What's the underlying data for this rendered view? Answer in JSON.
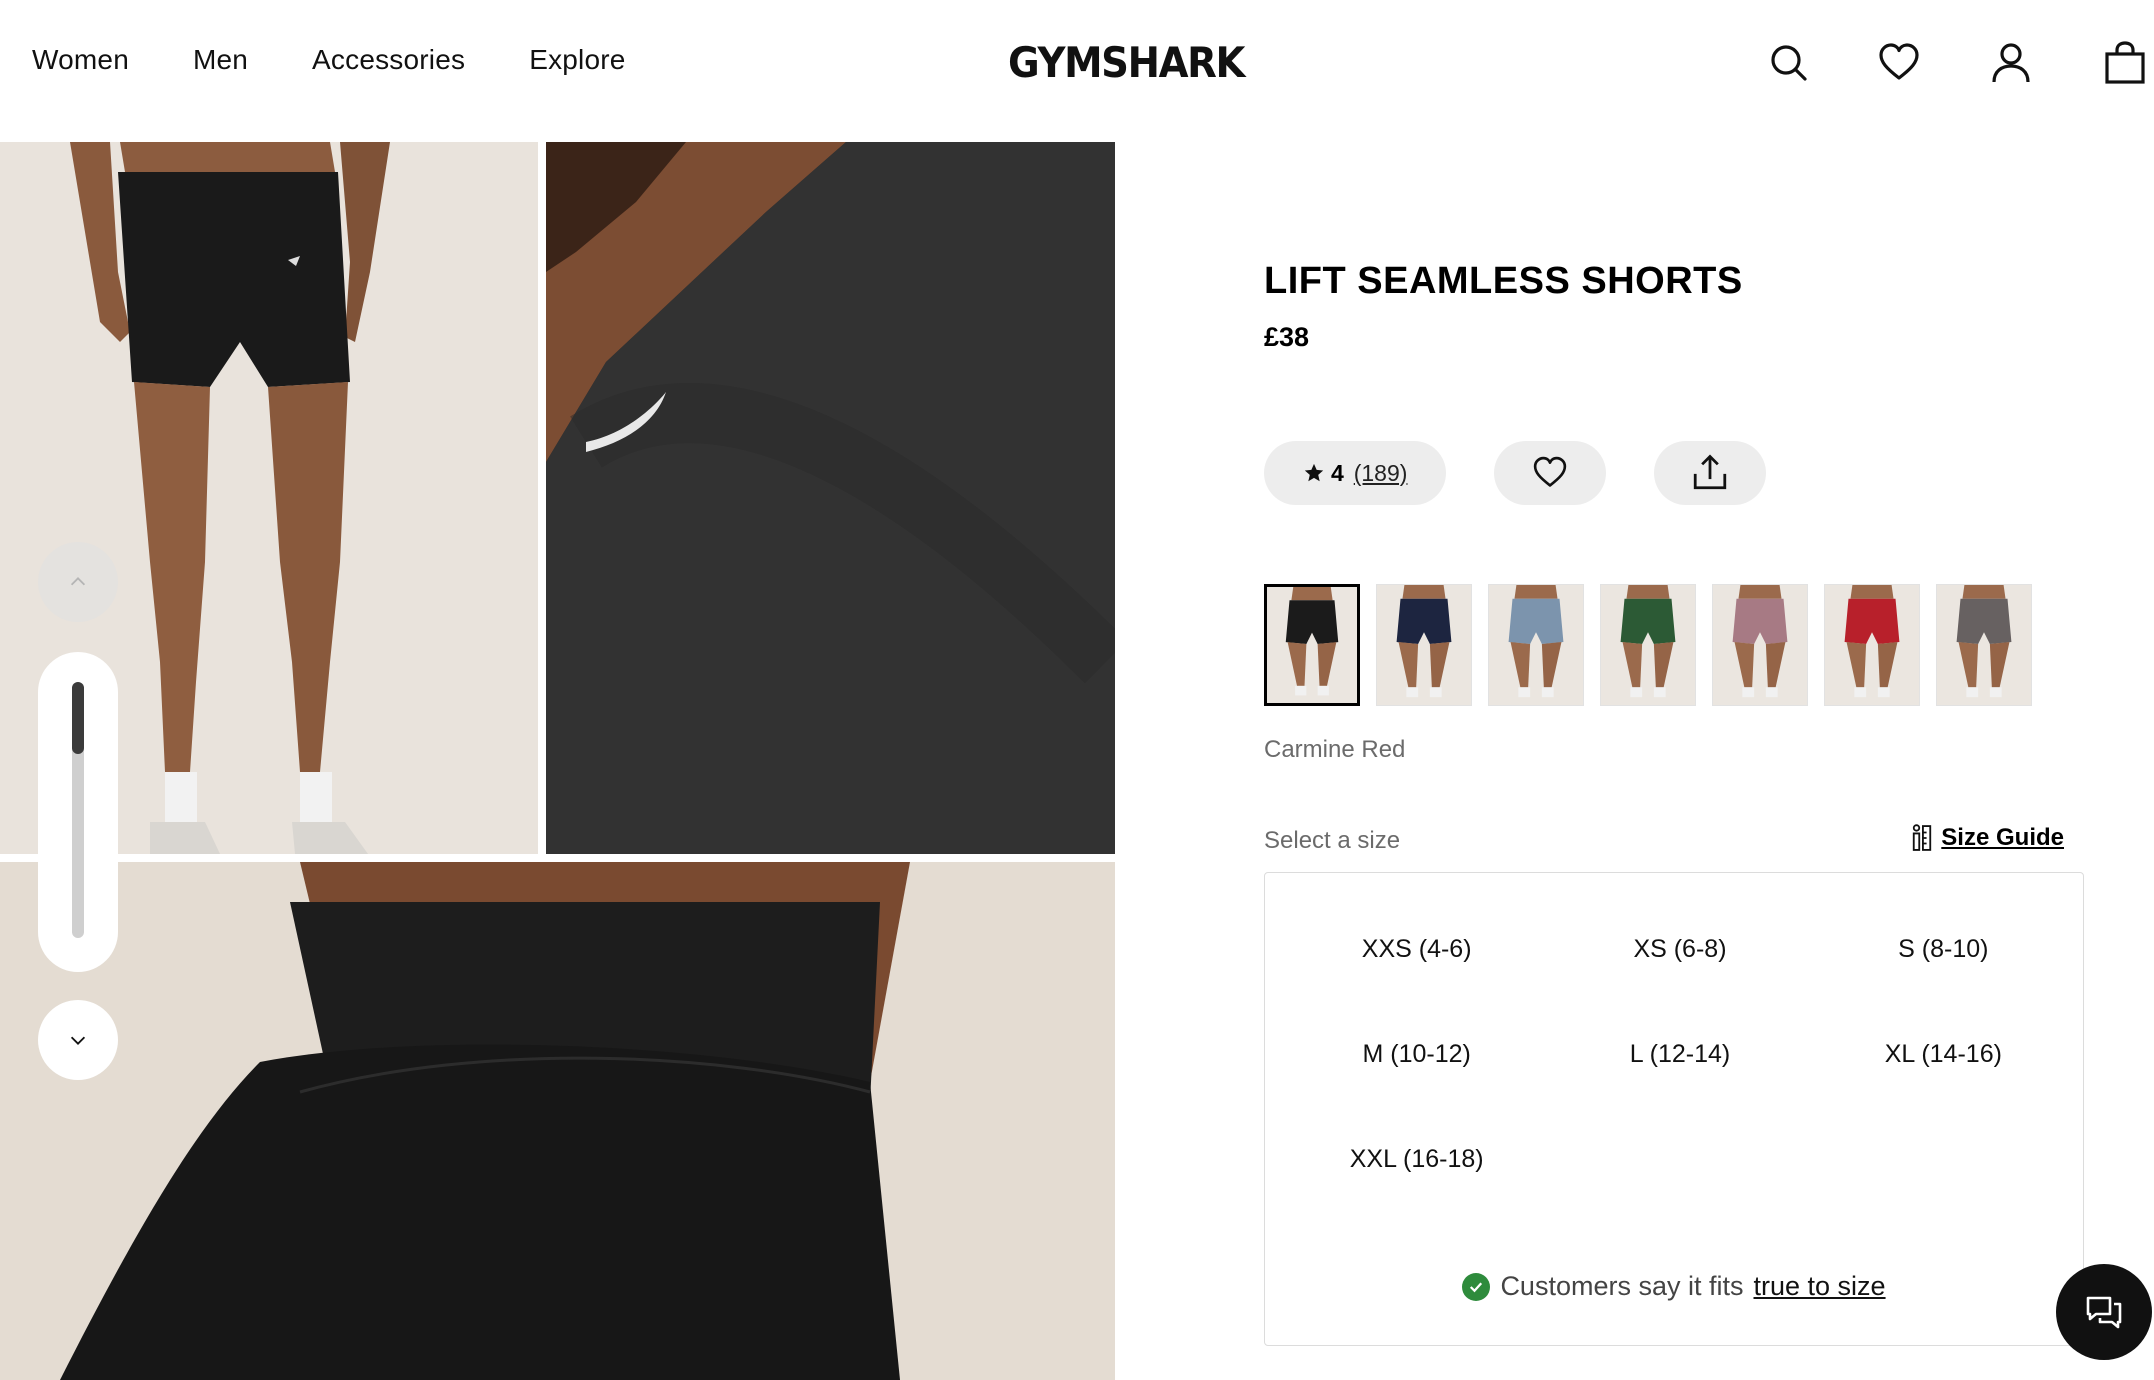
{
  "header": {
    "nav": [
      "Women",
      "Men",
      "Accessories",
      "Explore"
    ],
    "logo": "GYMSHARK",
    "icons": [
      "search-icon",
      "heart-icon",
      "account-icon",
      "bag-icon"
    ]
  },
  "product": {
    "title": "LIFT SEAMLESS SHORTS",
    "price": "£38",
    "rating": "4",
    "review_count": "(189)",
    "colour_name": "Carmine Red",
    "swatch_colors": [
      "#1b1b1b",
      "#1d2540",
      "#7c94ad",
      "#2c5a35",
      "#a77a84",
      "#b8202b",
      "#676161"
    ],
    "select_size_label": "Select a size",
    "size_guide_label": "Size Guide",
    "sizes": [
      "XXS (4-6)",
      "XS (6-8)",
      "S (8-10)",
      "M (10-12)",
      "L (12-14)",
      "XL (14-16)",
      "XXL (16-18)"
    ],
    "fit_note_prefix": "Customers say it fits",
    "fit_note_link": "true to size"
  },
  "colors": {
    "accent": "#000000",
    "pill_bg": "#ededed",
    "fit_check": "#2e8b3c",
    "muted_text": "#6b6b6b"
  }
}
